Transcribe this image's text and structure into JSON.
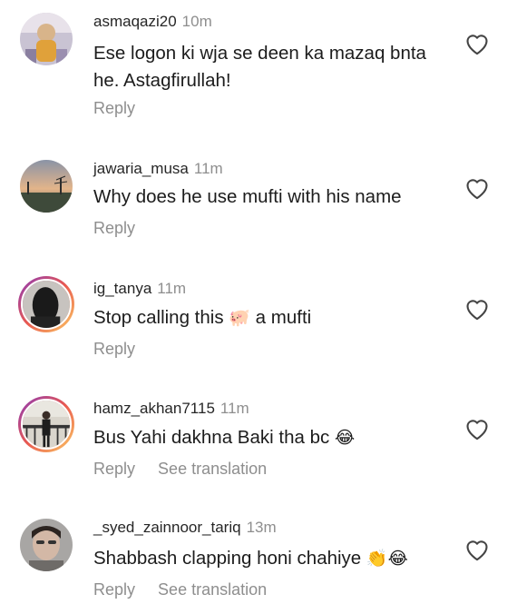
{
  "comments": [
    {
      "username": "asmaqazi20",
      "time": "10m",
      "text": "Ese logon ki wja se deen ka mazaq bnta he. Astagfirullah!",
      "reply_label": "Reply",
      "translation_label": ""
    },
    {
      "username": "jawaria_musa",
      "time": "11m",
      "text": "Why does he use mufti with his name",
      "reply_label": "Reply",
      "translation_label": ""
    },
    {
      "username": "ig_tanya",
      "time": "11m",
      "text_before": "Stop calling this",
      "emoji": "🐖",
      "text_after": "a mufti",
      "reply_label": "Reply",
      "translation_label": ""
    },
    {
      "username": "hamz_akhan7115",
      "time": "11m",
      "text": "Bus Yahi dakhna Baki tha bc",
      "emoji": "😂",
      "reply_label": "Reply",
      "translation_label": "See translation"
    },
    {
      "username": "_syed_zainnoor_tariq",
      "time": "13m",
      "text": "Shabbash clapping honi chahiye",
      "emoji": "👏😂",
      "reply_label": "Reply",
      "translation_label": "See translation"
    }
  ],
  "icons": {
    "like": "heart-outline-icon"
  },
  "colors": {
    "secondary_text": "#8e8e8e",
    "story_ring_start": "#8a3ab9",
    "story_ring_end": "#fccc63"
  }
}
